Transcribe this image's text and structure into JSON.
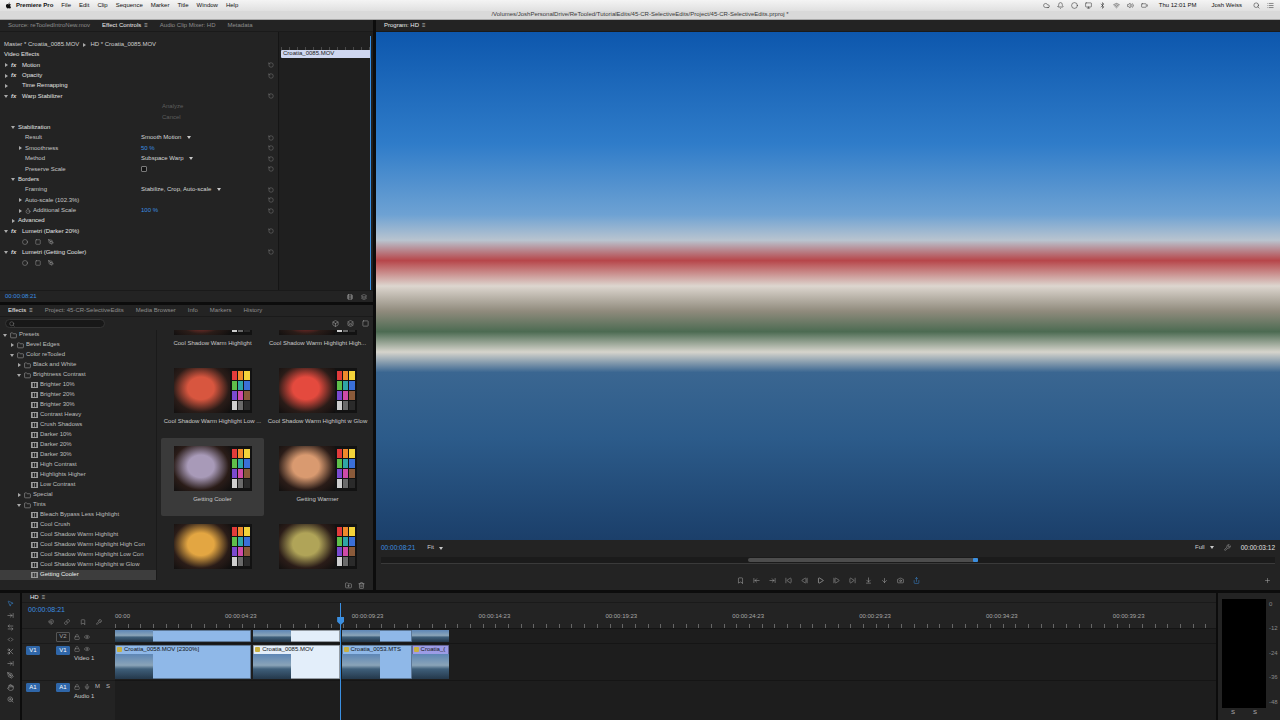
{
  "menu_bar": {
    "app": "Premiere Pro",
    "items": [
      "File",
      "Edit",
      "Clip",
      "Sequence",
      "Marker",
      "Title",
      "Window",
      "Help"
    ],
    "clock": "Thu 12:01 PM",
    "user": "Josh Weiss"
  },
  "window": {
    "title": "/Volumes/JoshPersonalDrive/ReTooled/TutorialEdits/45-CR-SelectiveEdits/Project/45-CR-SelectiveEdits.prproj *"
  },
  "panel_menu_icon": "≡",
  "effect_controls": {
    "tabs": [
      {
        "label": "Source: reTooledIntroNew.mov",
        "selected": false
      },
      {
        "label": "Effect Controls",
        "selected": true
      },
      {
        "label": "Audio Clip Mixer: HD",
        "selected": false
      },
      {
        "label": "Metadata",
        "selected": false
      }
    ],
    "master": "Master * Croatia_0085.MOV",
    "sequence_clip": "HD * Croatia_0085.MOV",
    "section": "Video Effects",
    "mini_timeline": {
      "clip": "Croatia_0085.MOV",
      "selected": true,
      "playhead": 0.97
    },
    "rows": [
      {
        "kind": "effect",
        "name": "Motion",
        "badge": "fx",
        "expanded": false,
        "depth": 0,
        "reset": true
      },
      {
        "kind": "effect",
        "name": "Opacity",
        "badge": "fx",
        "expanded": false,
        "depth": 0,
        "reset": true
      },
      {
        "kind": "effect",
        "name": "Time Remapping",
        "expanded": false,
        "depth": 0,
        "reset": false
      },
      {
        "kind": "effect",
        "name": "Warp Stabilizer",
        "badge": "fx",
        "expanded": true,
        "depth": 0,
        "reset": true
      },
      {
        "kind": "button",
        "label": "Analyze",
        "disabled": true
      },
      {
        "kind": "button",
        "label": "Cancel",
        "disabled": true
      },
      {
        "kind": "group",
        "name": "Stabilization",
        "expanded": true,
        "depth": 1,
        "reset": false
      },
      {
        "kind": "dropdown",
        "name": "Result",
        "value": "Smooth Motion",
        "depth": 2,
        "reset": true
      },
      {
        "kind": "value",
        "name": "Smoothness",
        "value": "50 %",
        "expanded": false,
        "depth": 2,
        "reset": true
      },
      {
        "kind": "dropdown",
        "name": "Method",
        "value": "Subspace Warp",
        "depth": 2,
        "reset": true
      },
      {
        "kind": "checkbox",
        "name": "Preserve Scale",
        "checked": false,
        "depth": 2,
        "reset": true
      },
      {
        "kind": "group",
        "name": "Borders",
        "expanded": true,
        "depth": 1,
        "reset": false
      },
      {
        "kind": "dropdown",
        "name": "Framing",
        "value": "Stabilize, Crop, Auto-scale",
        "depth": 2,
        "reset": true
      },
      {
        "kind": "value",
        "name": "Auto-scale (102.3%)",
        "expanded": false,
        "depth": 2,
        "reset": true
      },
      {
        "kind": "value",
        "name": "Additional Scale",
        "value": "100 %",
        "expanded": false,
        "stopwatch": true,
        "depth": 2,
        "reset": true
      },
      {
        "kind": "group",
        "name": "Advanced",
        "expanded": false,
        "depth": 1,
        "reset": false
      },
      {
        "kind": "effect",
        "name": "Lumetri (Darker 20%)",
        "badge": "fx",
        "expanded": true,
        "depth": 0,
        "reset": true
      },
      {
        "kind": "masks"
      },
      {
        "kind": "effect",
        "name": "Lumetri (Getting Cooler)",
        "badge": "fx",
        "expanded": true,
        "depth": 0,
        "reset": true
      },
      {
        "kind": "masks"
      }
    ],
    "timecode": "00:00:08:21"
  },
  "effects_panel": {
    "tabs": [
      {
        "label": "Effects",
        "selected": true
      },
      {
        "label": "Project: 45-CR-SelectiveEdits",
        "selected": false
      },
      {
        "label": "Media Browser",
        "selected": false
      },
      {
        "label": "Info",
        "selected": false
      },
      {
        "label": "Markers",
        "selected": false
      },
      {
        "label": "History",
        "selected": false
      }
    ],
    "tree": [
      {
        "label": "Presets",
        "kind": "folder",
        "depth": 0,
        "expanded": true,
        "selected": false
      },
      {
        "label": "Bevel Edges",
        "kind": "folder",
        "depth": 1,
        "expanded": false,
        "selected": false
      },
      {
        "label": "Color reTooled",
        "kind": "folder",
        "depth": 1,
        "expanded": true,
        "selected": false
      },
      {
        "label": "Black and White",
        "kind": "folder",
        "depth": 2,
        "expanded": false,
        "selected": false
      },
      {
        "label": "Brightness Contrast",
        "kind": "folder",
        "depth": 2,
        "expanded": true,
        "selected": false
      },
      {
        "label": "Brighter 10%",
        "kind": "preset",
        "depth": 3,
        "selected": false
      },
      {
        "label": "Brighter 20%",
        "kind": "preset",
        "depth": 3,
        "selected": false
      },
      {
        "label": "Brighter 30%",
        "kind": "preset",
        "depth": 3,
        "selected": false
      },
      {
        "label": "Contrast Heavy",
        "kind": "preset",
        "depth": 3,
        "selected": false
      },
      {
        "label": "Crush Shadows",
        "kind": "preset",
        "depth": 3,
        "selected": false
      },
      {
        "label": "Darker 10%",
        "kind": "preset",
        "depth": 3,
        "selected": false
      },
      {
        "label": "Darker 20%",
        "kind": "preset",
        "depth": 3,
        "selected": false
      },
      {
        "label": "Darker 30%",
        "kind": "preset",
        "depth": 3,
        "selected": false
      },
      {
        "label": "High Contrast",
        "kind": "preset",
        "depth": 3,
        "selected": false
      },
      {
        "label": "Highlights Higher",
        "kind": "preset",
        "depth": 3,
        "selected": false
      },
      {
        "label": "Low Contrast",
        "kind": "preset",
        "depth": 3,
        "selected": false
      },
      {
        "label": "Special",
        "kind": "folder",
        "depth": 2,
        "expanded": false,
        "selected": false
      },
      {
        "label": "Tints",
        "kind": "folder",
        "depth": 2,
        "expanded": true,
        "selected": false
      },
      {
        "label": "Bleach Bypass Less Highlight",
        "kind": "preset",
        "depth": 3,
        "selected": false
      },
      {
        "label": "Cool Crush",
        "kind": "preset",
        "depth": 3,
        "selected": false
      },
      {
        "label": "Cool Shadow Warm Highlight",
        "kind": "preset",
        "depth": 3,
        "selected": false
      },
      {
        "label": "Cool Shadow Warm Highlight High Con",
        "kind": "preset",
        "depth": 3,
        "selected": false
      },
      {
        "label": "Cool Shadow Warm Highlight Low Con",
        "kind": "preset",
        "depth": 3,
        "selected": false
      },
      {
        "label": "Cool Shadow Warm Highlight w Glow",
        "kind": "preset",
        "depth": 3,
        "selected": false
      },
      {
        "label": "Getting Cooler",
        "kind": "preset",
        "depth": 3,
        "selected": true
      }
    ],
    "thumbnails": [
      {
        "label": "Cool Shadow Warm Highlight",
        "color": "#c8403a",
        "selected": false
      },
      {
        "label": "Cool Shadow Warm Highlight High...",
        "color": "#c43535",
        "selected": false
      },
      {
        "label": "Cool Shadow Warm Highlight Low ...",
        "color": "#d8563f",
        "selected": false
      },
      {
        "label": "Cool Shadow Warm Highlight w Glow",
        "color": "#e44a3e",
        "selected": false
      },
      {
        "label": "Getting Cooler",
        "color": "#a89ab8",
        "selected": true
      },
      {
        "label": "Getting Warmer",
        "color": "#d99a70",
        "selected": false
      },
      {
        "color": "#e3a642",
        "selected": false
      },
      {
        "color": "#b0a458",
        "selected": false
      }
    ]
  },
  "program_monitor": {
    "tabs": [
      {
        "label": "Program: HD",
        "selected": true
      }
    ],
    "timecode": "00:00:08:21",
    "zoom": "Fit",
    "quality": "Full",
    "duration": "00:00:03:12",
    "navigator": {
      "start": 0.41,
      "end": 0.668
    }
  },
  "timeline": {
    "tabs": [
      {
        "label": "HD",
        "selected": true
      }
    ],
    "timecode": "00:00:08:21",
    "span_seconds": 43.4,
    "playhead_seconds": 8.875,
    "ruler": [
      {
        "label": "00:00",
        "seconds": 0
      },
      {
        "label": "00:00:04:23",
        "seconds": 4.958
      },
      {
        "label": "00:00:09:23",
        "seconds": 9.958
      },
      {
        "label": "00:00:14:23",
        "seconds": 14.958
      },
      {
        "label": "00:00:19:23",
        "seconds": 19.958
      },
      {
        "label": "00:00:24:23",
        "seconds": 24.958
      },
      {
        "label": "00:00:29:23",
        "seconds": 29.958
      },
      {
        "label": "00:00:34:23",
        "seconds": 34.958
      },
      {
        "label": "00:00:39:23",
        "seconds": 39.958
      }
    ],
    "tracks": [
      {
        "kind": "video",
        "target": "V2",
        "target_on": false,
        "source": null,
        "name": null,
        "buttons": [],
        "clips": [
          {
            "start": 0,
            "end": 5.37,
            "color": "#8fb8e8",
            "selected": false
          },
          {
            "start": 5.45,
            "end": 8.875,
            "color": "#8fb8e8",
            "selected": true
          },
          {
            "start": 8.93,
            "end": 11.69,
            "color": "#8fb8e8",
            "selected": false
          },
          {
            "start": 11.69,
            "end": 13.16,
            "color": "#9c9ce6",
            "selected": false
          }
        ]
      },
      {
        "kind": "video",
        "target": "V1",
        "target_on": true,
        "source": "V1",
        "name": "Video 1",
        "buttons": [],
        "clips": [
          {
            "name": "Croatia_0058.MOV [2300%]",
            "start": 0,
            "end": 5.37,
            "color": "#8fb8e8",
            "selected": false
          },
          {
            "name": "Croatia_0085.MOV",
            "start": 5.45,
            "end": 8.875,
            "color": "#8fb8e8",
            "selected": true
          },
          {
            "name": "Croatia_0053.MTS",
            "start": 8.93,
            "end": 11.69,
            "color": "#8fb8e8",
            "selected": false
          },
          {
            "name": "Croatia_(",
            "start": 11.69,
            "end": 13.16,
            "color": "#9c9ce6",
            "selected": false
          }
        ]
      },
      {
        "kind": "audio",
        "target": "A1",
        "target_on": true,
        "source": "A1",
        "name": "Audio 1",
        "buttons": [
          "M",
          "S"
        ],
        "clips": []
      }
    ]
  },
  "audio_meter": {
    "ticks": [
      "0",
      "-12",
      "-24",
      "-36",
      "-48"
    ],
    "buttons": [
      "S",
      "S"
    ]
  }
}
